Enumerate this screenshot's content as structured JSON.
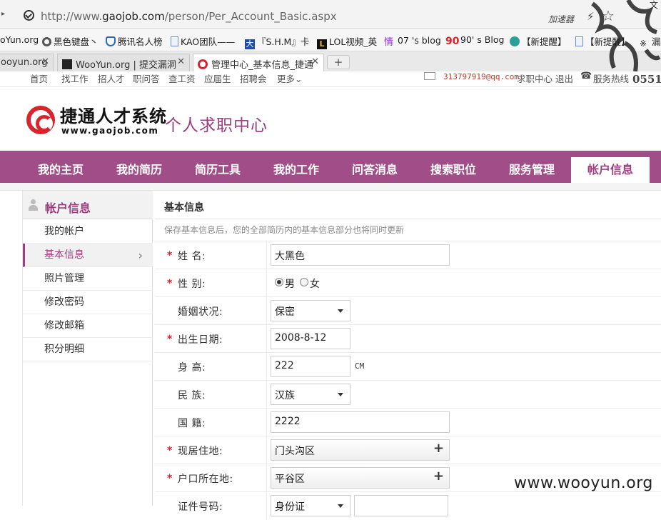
{
  "browser": {
    "url_prefix": "http://www.",
    "url_domain": "gaojob.com",
    "url_path": "/person/Per_Account_Basic.aspx",
    "accelerator": "加速器",
    "extra": "文",
    "bookmarks": [
      "oYun.org",
      "黑色键盘丶",
      "腾讯名人榜",
      "KAO团队——",
      "『S.H.M』卡",
      "LOL视频_英",
      "07 's blog",
      "90' s Blog",
      "【新提醒】",
      "【新提醒】",
      "漏洞"
    ],
    "bookmark_glyphs": {
      "chinese_tao": "大",
      "lol": "L",
      "qing": "情",
      "ninety": "90"
    },
    "tabs": [
      "ooyun.org",
      "WooYun.org | 提交漏洞",
      "管理中心_基本信息_捷通"
    ],
    "new_tab": "+"
  },
  "site": {
    "top_links": [
      "首页",
      "找工作",
      "招人才",
      "职问答",
      "查工资",
      "应届生",
      "招聘会",
      "更多"
    ],
    "more_arrow": "⌄",
    "email": "313797919@qq.com",
    "job_center": "求职中心",
    "logout": "退出",
    "hotline_label": "服务热线",
    "hotline_num": "0551",
    "logo_cn": "捷通人才系统",
    "logo_en": "www.gaojob.com",
    "center_title": "个人求职中心",
    "nav": [
      "我的主页",
      "我的简历",
      "简历工具",
      "我的工作",
      "问答消息",
      "搜索职位",
      "服务管理",
      "帐户信息"
    ]
  },
  "sidebar": {
    "title": "帐户信息",
    "items": [
      "我的帐户",
      "基本信息",
      "照片管理",
      "修改密码",
      "修改邮箱",
      "积分明细"
    ],
    "active_chevron": "›"
  },
  "form": {
    "title": "基本信息",
    "hint": "保存基本信息后，您的全部简历内的基本信息部分也将同时更新",
    "required_mark": "*",
    "name_label": "姓  名:",
    "name_value": "大黑色",
    "gender_label": "性  别:",
    "gender_options": [
      "男",
      "女"
    ],
    "marital_label": "婚姻状况:",
    "marital_value": "保密",
    "birth_label": "出生日期:",
    "birth_value": "2008-8-12",
    "height_label": "身  高:",
    "height_value": "222",
    "height_unit": "CM",
    "ethnic_label": "民  族:",
    "ethnic_value": "汉族",
    "nationality_label": "国  籍:",
    "nationality_value": "2222",
    "residence_label": "现居住地:",
    "residence_value": "门头沟区",
    "hukou_label": "户口所在地:",
    "hukou_value": "平谷区",
    "idtype_label": "证件号码:",
    "idtype_value": "身份证",
    "picker_plus": "+"
  },
  "watermark": "www.wooyun.org",
  "colors": {
    "brand": "#a14d87",
    "accent_red": "#d9232d"
  }
}
